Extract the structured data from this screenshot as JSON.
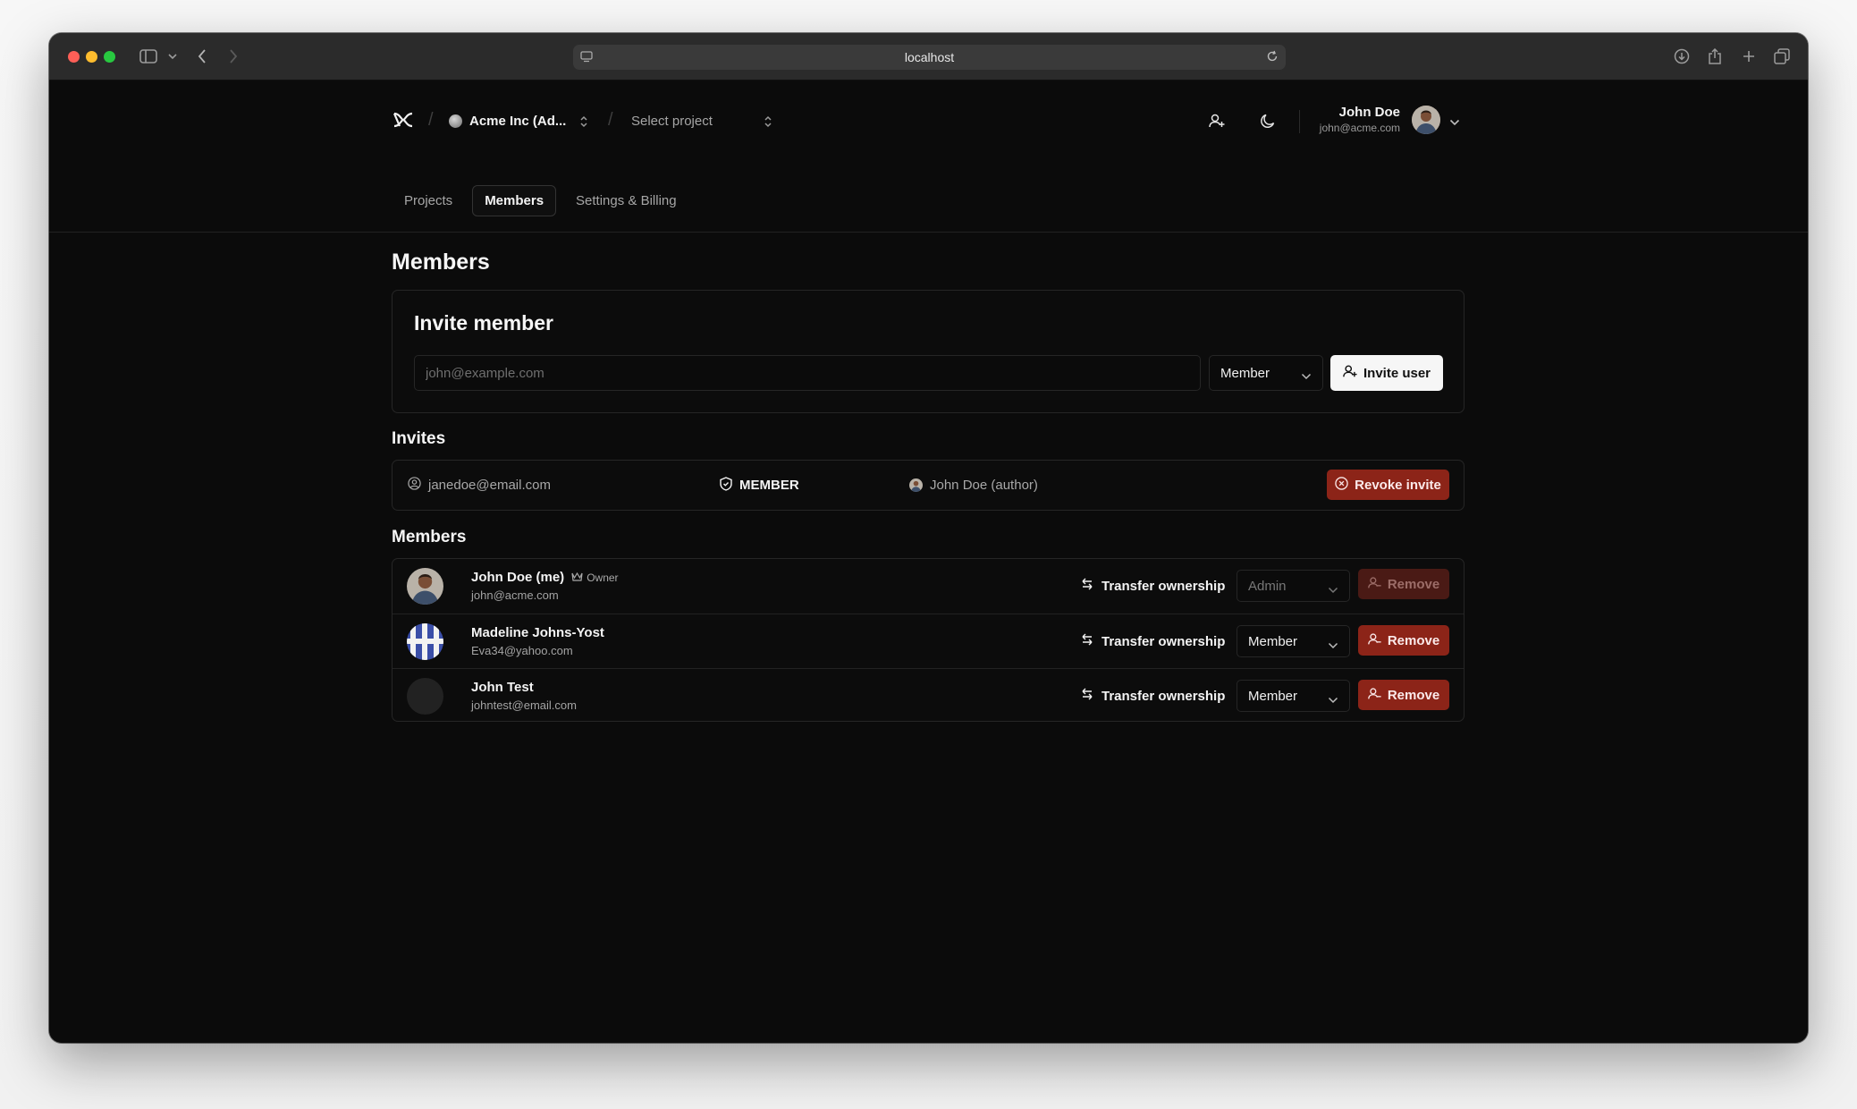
{
  "browser": {
    "address": "localhost"
  },
  "header": {
    "org_name": "Acme Inc (Ad...",
    "project_placeholder": "Select project",
    "user_name": "John Doe",
    "user_email": "john@acme.com"
  },
  "tabs": [
    {
      "label": "Projects",
      "active": false
    },
    {
      "label": "Members",
      "active": true
    },
    {
      "label": "Settings & Billing",
      "active": false
    }
  ],
  "page": {
    "title": "Members"
  },
  "invite_card": {
    "title": "Invite member",
    "email_placeholder": "john@example.com",
    "role_value": "Member",
    "submit_label": "Invite user"
  },
  "invites": {
    "heading": "Invites",
    "items": [
      {
        "email": "janedoe@email.com",
        "role": "MEMBER",
        "author": "John Doe (author)",
        "action": "Revoke invite"
      }
    ]
  },
  "members": {
    "heading": "Members",
    "transfer_label": "Transfer ownership",
    "remove_label": "Remove",
    "rows": [
      {
        "name": "John Doe (me)",
        "badge": "Owner",
        "email": "john@acme.com",
        "role": "Admin"
      },
      {
        "name": "Madeline Johns-Yost",
        "badge": "",
        "email": "Eva34@yahoo.com",
        "role": "Member"
      },
      {
        "name": "John Test",
        "badge": "",
        "email": "johntest@email.com",
        "role": "Member"
      }
    ]
  },
  "colors": {
    "background": "#0b0b0b",
    "danger": "#8c2418",
    "border": "#262626"
  }
}
